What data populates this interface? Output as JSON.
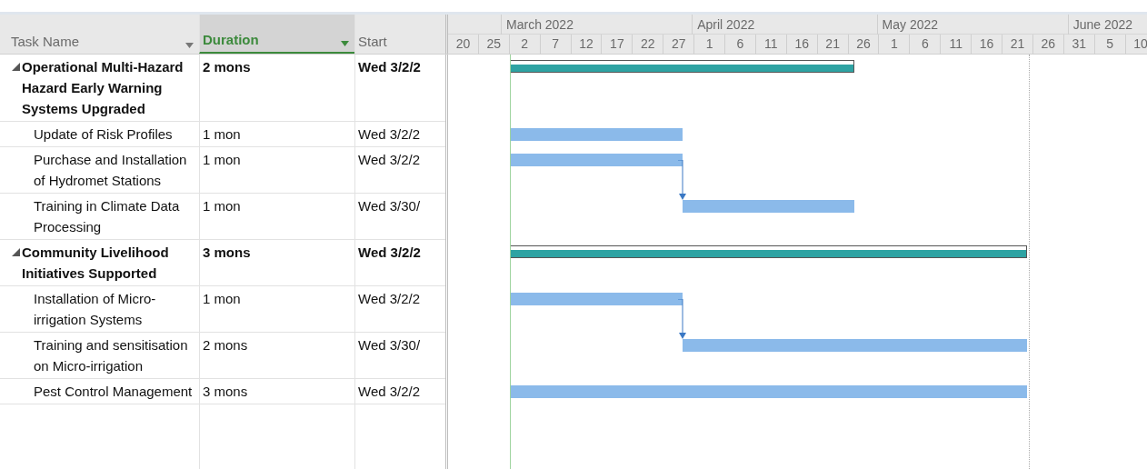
{
  "columns": [
    {
      "label": "Task Name",
      "selected": false,
      "filter": true
    },
    {
      "label": "Duration",
      "selected": true,
      "filter": true
    },
    {
      "label": "Start",
      "selected": false,
      "filter": false
    }
  ],
  "timescale": {
    "months": [
      "March 2022",
      "April 2022",
      "May 2022",
      "June 2022"
    ],
    "days": [
      "20",
      "25",
      "2",
      "7",
      "12",
      "17",
      "22",
      "27",
      "1",
      "6",
      "11",
      "16",
      "21",
      "26",
      "1",
      "6",
      "11",
      "16",
      "21",
      "26",
      "31",
      "5",
      "10"
    ]
  },
  "tasks": [
    {
      "name": "Operational Multi-Hazard Hazard Early Warning Systems Upgraded",
      "duration": "2 mons",
      "start": "Wed 3/2/2",
      "expanded": true,
      "bar": {
        "kind": "summary"
      },
      "children": [
        {
          "name": "Update of Risk Profiles",
          "duration": "1 mon",
          "start": "Wed 3/2/2",
          "bar": {
            "kind": "task"
          }
        },
        {
          "name": "Purchase and Installation of Hydromet Stations",
          "duration": "1 mon",
          "start": "Wed 3/2/2",
          "bar": {
            "kind": "task"
          }
        },
        {
          "name": "Training in Climate Data Processing",
          "duration": "1 mon",
          "start": "Wed 3/30/",
          "bar": {
            "kind": "task",
            "linked": true
          }
        }
      ]
    },
    {
      "name": "Community Livelihood Initiatives Supported",
      "duration": "3 mons",
      "start": "Wed 3/2/2",
      "expanded": true,
      "bar": {
        "kind": "summary"
      },
      "children": [
        {
          "name": "Installation of Micro-irrigation Systems",
          "duration": "1 mon",
          "start": "Wed 3/2/2",
          "bar": {
            "kind": "task"
          }
        },
        {
          "name": "Training and sensitisation on Micro-irrigation",
          "duration": "2 mons",
          "start": "Wed 3/30/",
          "bar": {
            "kind": "task",
            "linked": true
          }
        },
        {
          "name": "Pest Control Management",
          "duration": "3 mons",
          "start": "Wed 3/2/2",
          "bar": {
            "kind": "task"
          }
        }
      ]
    }
  ]
}
